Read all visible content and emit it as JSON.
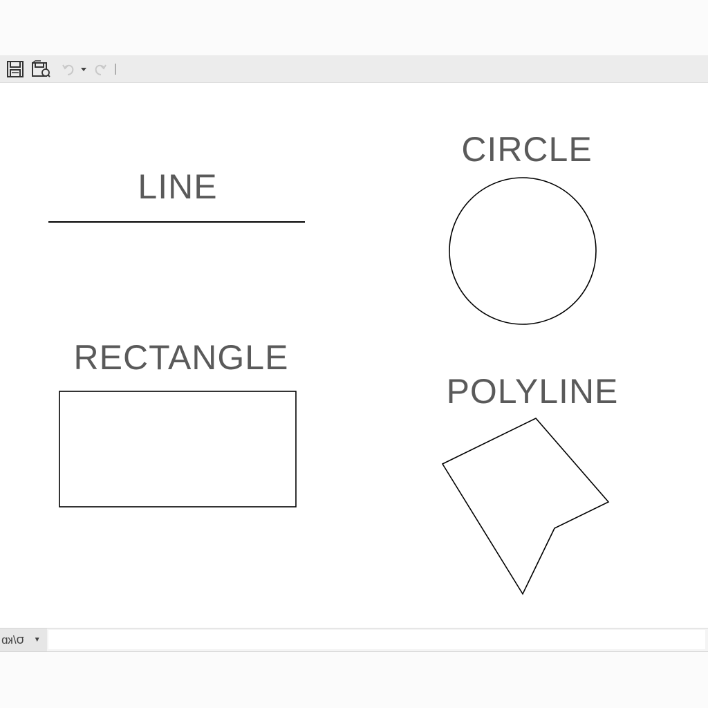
{
  "toolbar": {
    "icons": [
      "save-icon",
      "save-as-icon",
      "undo-icon",
      "dropdown-arrow-icon",
      "redo-icon",
      "separator"
    ]
  },
  "shapes": {
    "line": {
      "label": "LINE"
    },
    "circle": {
      "label": "CIRCLE"
    },
    "rectangle": {
      "label": "RECTANGLE"
    },
    "polyline": {
      "label": "POLYLINE"
    }
  },
  "command_bar": {
    "prompt_text": "ס/кɒ",
    "input_value": "",
    "input_placeholder": ""
  },
  "colors": {
    "label_gray": "#5a5a5a",
    "stroke": "#000000",
    "toolbar_bg": "#ececec"
  }
}
